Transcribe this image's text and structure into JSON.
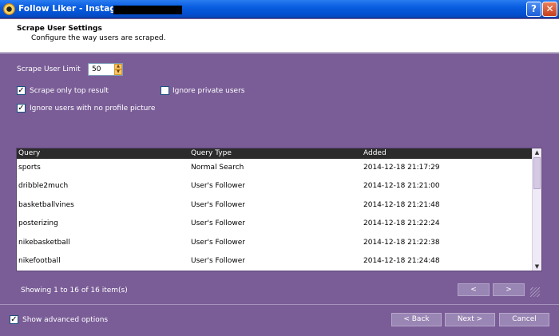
{
  "window": {
    "title": "Follow Liker - Instagram"
  },
  "header": {
    "title": "Scrape User Settings",
    "subtitle": "Configure the way users are scraped."
  },
  "options": {
    "scrape_limit_label": "Scrape User Limit",
    "scrape_limit_value": "50",
    "top_result_label": "Scrape only top result",
    "top_result_checked": true,
    "ignore_private_label": "Ignore private users",
    "ignore_private_checked": false,
    "ignore_no_pic_label": "Ignore users with no profile picture",
    "ignore_no_pic_checked": true
  },
  "grid": {
    "columns": [
      "Query",
      "Query Type",
      "Added"
    ],
    "rows": [
      {
        "query": "sports",
        "type": "Normal Search",
        "added": "2014-12-18 21:17:29"
      },
      {
        "query": "dribble2much",
        "type": "User's Follower",
        "added": "2014-12-18 21:21:00"
      },
      {
        "query": "basketballvines",
        "type": "User's Follower",
        "added": "2014-12-18 21:21:48"
      },
      {
        "query": "posterizing",
        "type": "User's Follower",
        "added": "2014-12-18 21:22:24"
      },
      {
        "query": "nikebasketball",
        "type": "User's Follower",
        "added": "2014-12-18 21:22:38"
      },
      {
        "query": "nikefootball",
        "type": "User's Follower",
        "added": "2014-12-18 21:24:48"
      }
    ]
  },
  "pager": {
    "status": "Showing 1 to 16 of 16 item(s)",
    "prev": "<",
    "next": ">"
  },
  "footer": {
    "advanced_label": "Show advanced options",
    "advanced_checked": true,
    "back": "< Back",
    "next": "Next >",
    "cancel": "Cancel"
  }
}
